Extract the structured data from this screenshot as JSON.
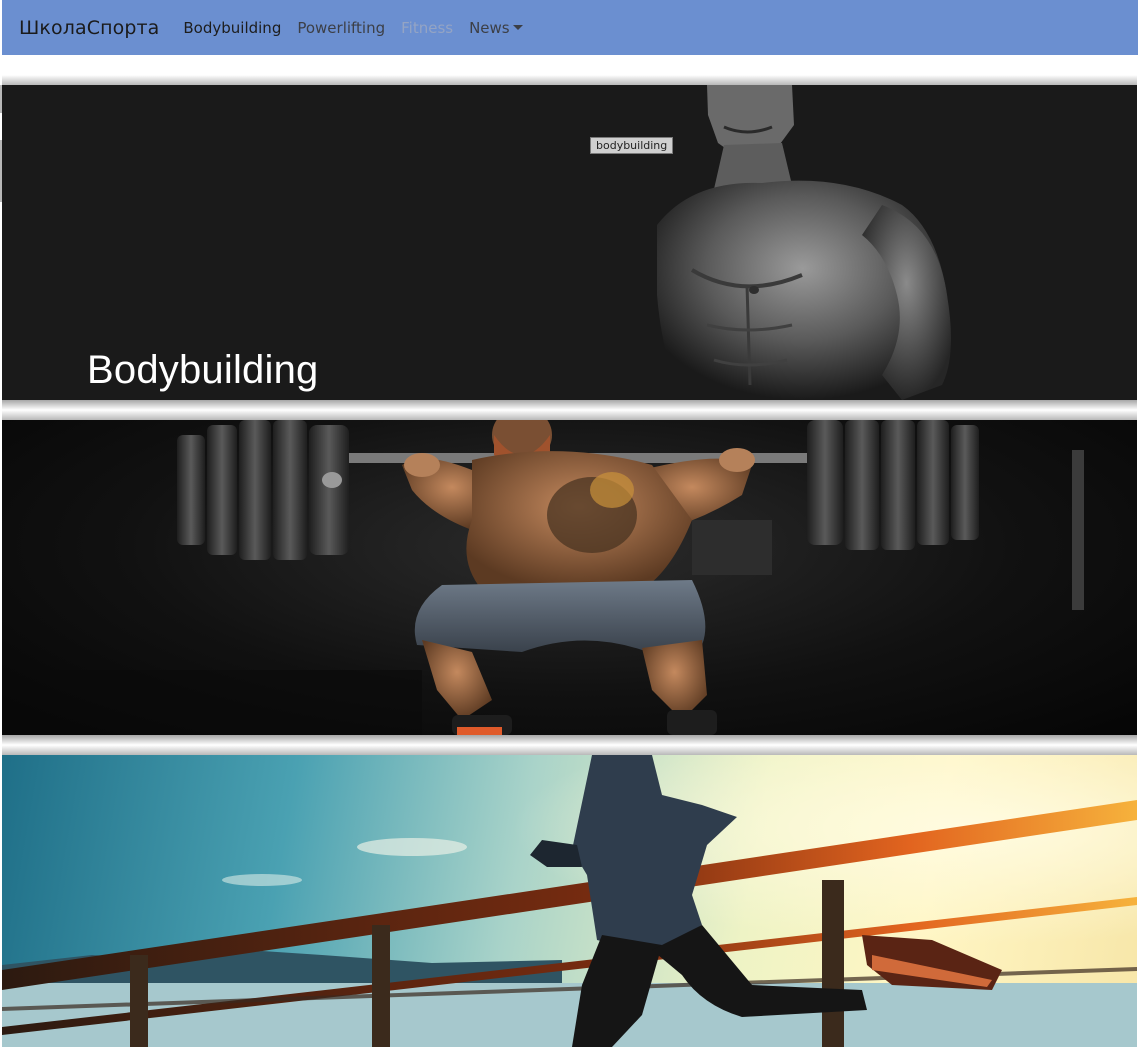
{
  "navbar": {
    "brand": "ШколаСпорта",
    "items": [
      {
        "label": "Bodybuilding",
        "state": "active"
      },
      {
        "label": "Powerlifting",
        "state": "normal"
      },
      {
        "label": "Fitness",
        "state": "muted"
      },
      {
        "label": "News",
        "state": "normal",
        "dropdown": true
      }
    ],
    "color": "#6b8fd0"
  },
  "banners": [
    {
      "tooltip": "bodybuilding",
      "title": "Bodybuilding",
      "theme": "dark grayscale"
    },
    {
      "title": "",
      "theme": "dark gym"
    },
    {
      "title": "",
      "theme": "sunrise sky"
    }
  ]
}
